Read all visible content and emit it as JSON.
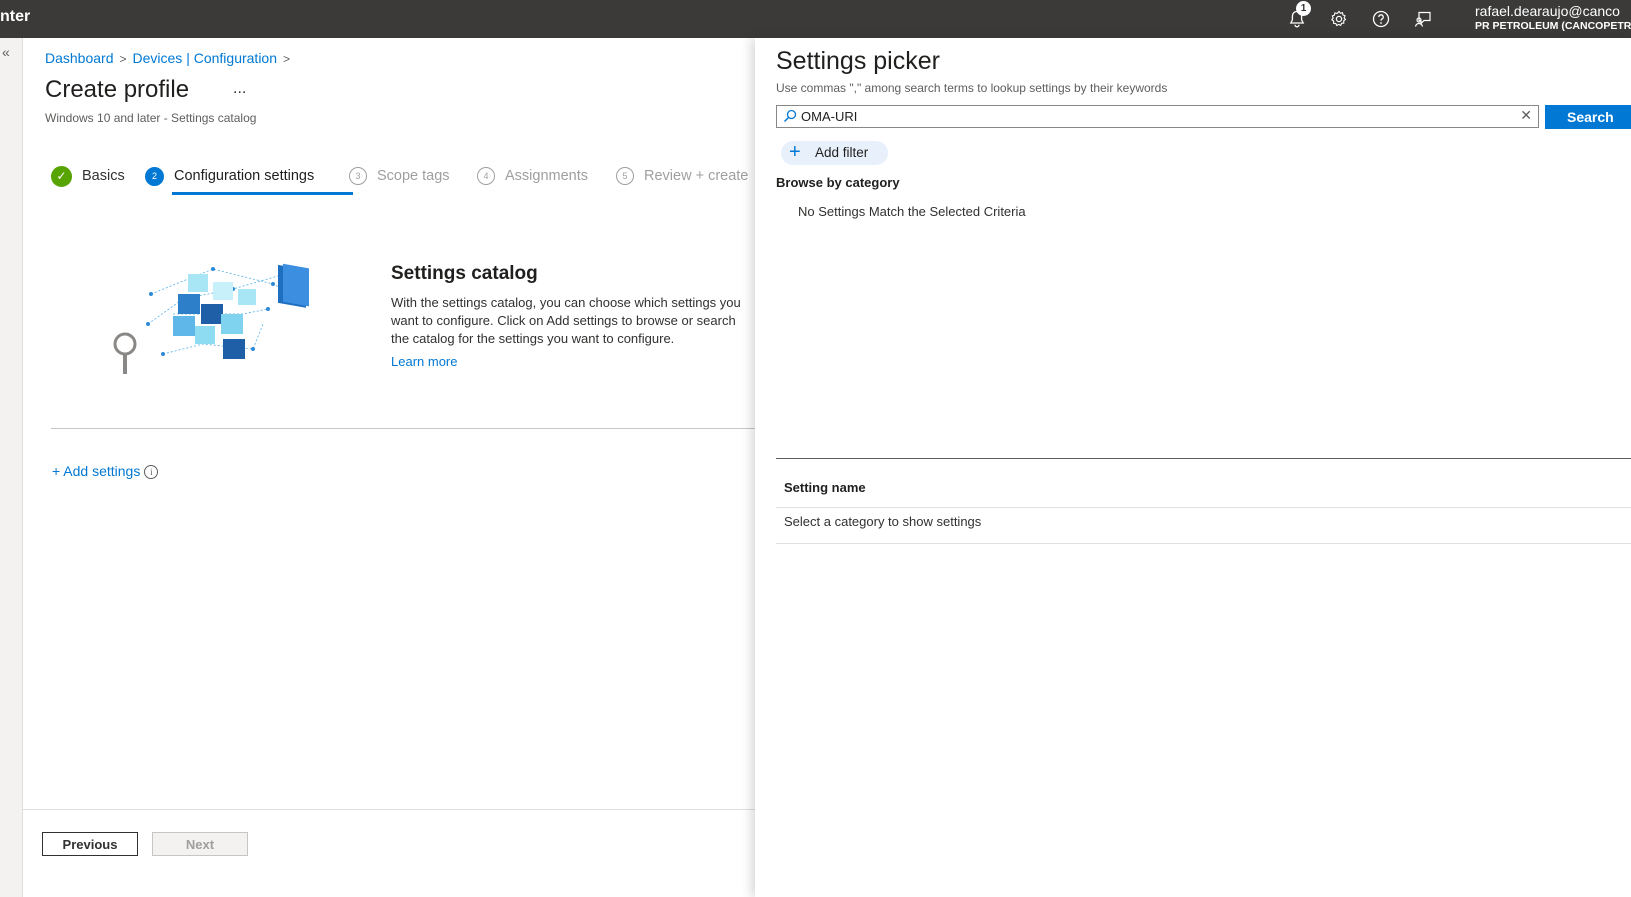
{
  "topbar": {
    "brand": "nter",
    "notification_count": "1",
    "icons": [
      "bell-icon",
      "gear-icon",
      "help-icon",
      "feedback-icon"
    ],
    "user_email": "rafael.dearaujo@canco",
    "user_tenant": "PR PETROLEUM (CANCOPETRO"
  },
  "sidebar": {
    "collapse_glyph": "«"
  },
  "breadcrumb": {
    "items": [
      "Dashboard",
      "Devices | Configuration"
    ],
    "separator": ">"
  },
  "page": {
    "title": "Create profile",
    "more": "...",
    "subtitle": "Windows 10 and later - Settings catalog"
  },
  "steps": [
    {
      "label": "Basics",
      "num": "✓",
      "state": "done"
    },
    {
      "label": "Configuration settings",
      "num": "2",
      "state": "current"
    },
    {
      "label": "Scope tags",
      "num": "3",
      "state": "future"
    },
    {
      "label": "Assignments",
      "num": "4",
      "state": "future"
    },
    {
      "label": "Review + create",
      "num": "5",
      "state": "future"
    }
  ],
  "catalog": {
    "title": "Settings catalog",
    "description": "With the settings catalog, you can choose which settings you want to configure. Click on Add settings to browse or search the catalog for the settings you want to configure.",
    "learn_more": "Learn more"
  },
  "add_settings": "+ Add settings",
  "footer": {
    "previous": "Previous",
    "next": "Next"
  },
  "picker": {
    "title": "Settings picker",
    "hint": "Use commas \",\" among search terms to lookup settings by their keywords",
    "search_value": "OMA-URI",
    "search_button": "Search",
    "add_filter": "Add filter",
    "browse_label": "Browse by category",
    "no_match": "No Settings Match the Selected Criteria",
    "column_header": "Setting name",
    "row_text": "Select a category to show settings"
  },
  "colors": {
    "accent": "#0078d4",
    "topbar": "#3b3a39",
    "success": "#57a300"
  }
}
